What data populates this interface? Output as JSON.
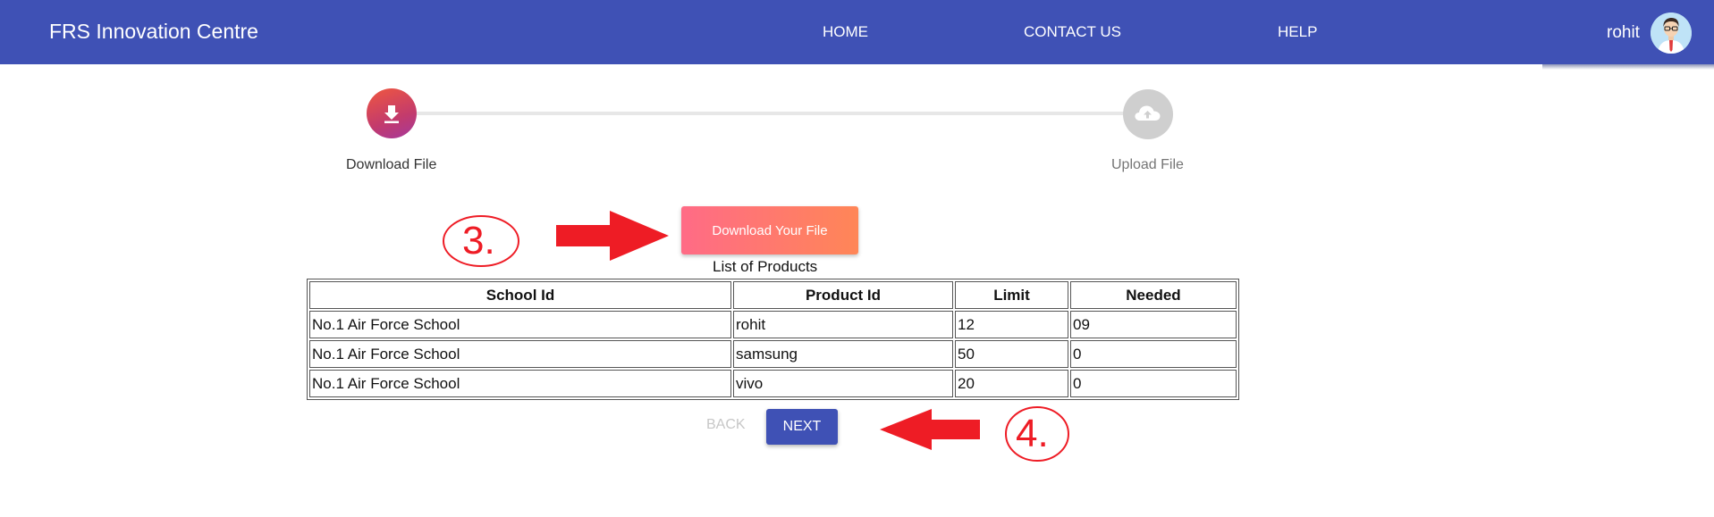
{
  "header": {
    "brand": "FRS Innovation Centre",
    "nav": [
      "HOME",
      "CONTACT US",
      "HELP"
    ],
    "username": "rohit"
  },
  "stepper": {
    "steps": [
      {
        "label": "Download File",
        "icon": "download-icon",
        "state": "active"
      },
      {
        "label": "Upload File",
        "icon": "cloud-upload-icon",
        "state": "inactive"
      }
    ]
  },
  "download_button": "Download Your File",
  "list_title": "List of Products",
  "table": {
    "headers": [
      "School Id",
      "Product Id",
      "Limit",
      "Needed"
    ],
    "rows": [
      [
        "No.1 Air Force School",
        "rohit",
        "12",
        "09"
      ],
      [
        "No.1 Air Force School",
        "samsung",
        "50",
        "0"
      ],
      [
        "No.1 Air Force School",
        "vivo",
        "20",
        "0"
      ]
    ]
  },
  "actions": {
    "back": "BACK",
    "next": "NEXT"
  },
  "annotations": {
    "step3": "3.",
    "step4": "4."
  },
  "colors": {
    "primary": "#3f51b5",
    "annotation_red": "#ee1c25",
    "download_gradient_start": "#ff6b86",
    "download_gradient_end": "#ff8657"
  }
}
